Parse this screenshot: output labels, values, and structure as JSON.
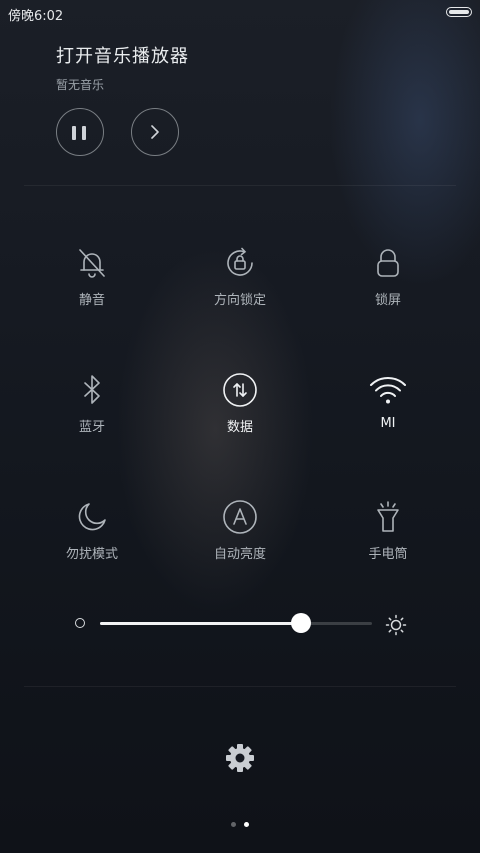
{
  "status": {
    "time": "傍晚6:02"
  },
  "music": {
    "title": "打开音乐播放器",
    "subtitle": "暂无音乐"
  },
  "toggles": [
    {
      "label": "静音",
      "icon": "bell-off-icon",
      "active": false
    },
    {
      "label": "方向锁定",
      "icon": "rotation-lock-icon",
      "active": false
    },
    {
      "label": "锁屏",
      "icon": "lock-icon",
      "active": false
    },
    {
      "label": "蓝牙",
      "icon": "bluetooth-icon",
      "active": false
    },
    {
      "label": "数据",
      "icon": "mobile-data-icon",
      "active": true
    },
    {
      "label": "MI",
      "icon": "wifi-icon",
      "active": true
    },
    {
      "label": "勿扰模式",
      "icon": "moon-icon",
      "active": false
    },
    {
      "label": "自动亮度",
      "icon": "auto-brightness-icon",
      "active": false
    },
    {
      "label": "手电筒",
      "icon": "flashlight-icon",
      "active": false
    }
  ],
  "brightness": {
    "level": 0.74
  },
  "pager": {
    "count": 2,
    "current": 2
  },
  "colors": {
    "active": "#f0f2f4",
    "inactive": "#aeb4ba"
  }
}
